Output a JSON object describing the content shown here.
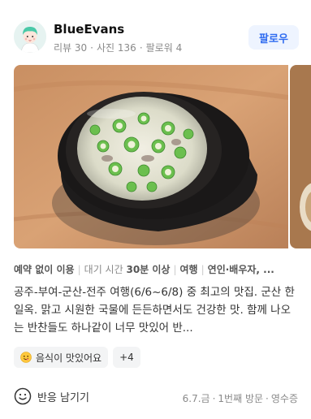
{
  "profile": {
    "username": "BlueEvans",
    "reviews": "리뷰 30",
    "photos": "사진 136",
    "followers": "팔로워 4",
    "follow_label": "팔로우"
  },
  "tags": {
    "tag1": "예약 없이 이용",
    "tag2_label": "대기 시간",
    "tag2_value": "30분 이상",
    "tag3": "여행",
    "tag4": "연인·배우자, ..."
  },
  "review": {
    "text": "공주-부여-군산-전주 여행(6/6~6/8) 중 최고의 맛집. 군산 한일옥. 맑고 시원한 국물에 든든하면서도 건강한 맛. 함께 나오는 반찬들도 하나같이 너무 맛있어 반..."
  },
  "keywords": {
    "chip_label": "음식이 맛있어요",
    "more_label": "+4"
  },
  "footer": {
    "react_label": "반응 남기기",
    "date": "6.7.금",
    "visit": "1번째 방문",
    "receipt": "영수증"
  },
  "icons": {
    "avatar": "avatar-illustration",
    "smile": "smile-icon",
    "emoji": "yum-emoji-icon"
  },
  "colors": {
    "accent": "#2f6bf0",
    "follow_bg": "#eef4ff",
    "chip_bg": "#f3f4f5",
    "muted": "#8a8a8a"
  }
}
